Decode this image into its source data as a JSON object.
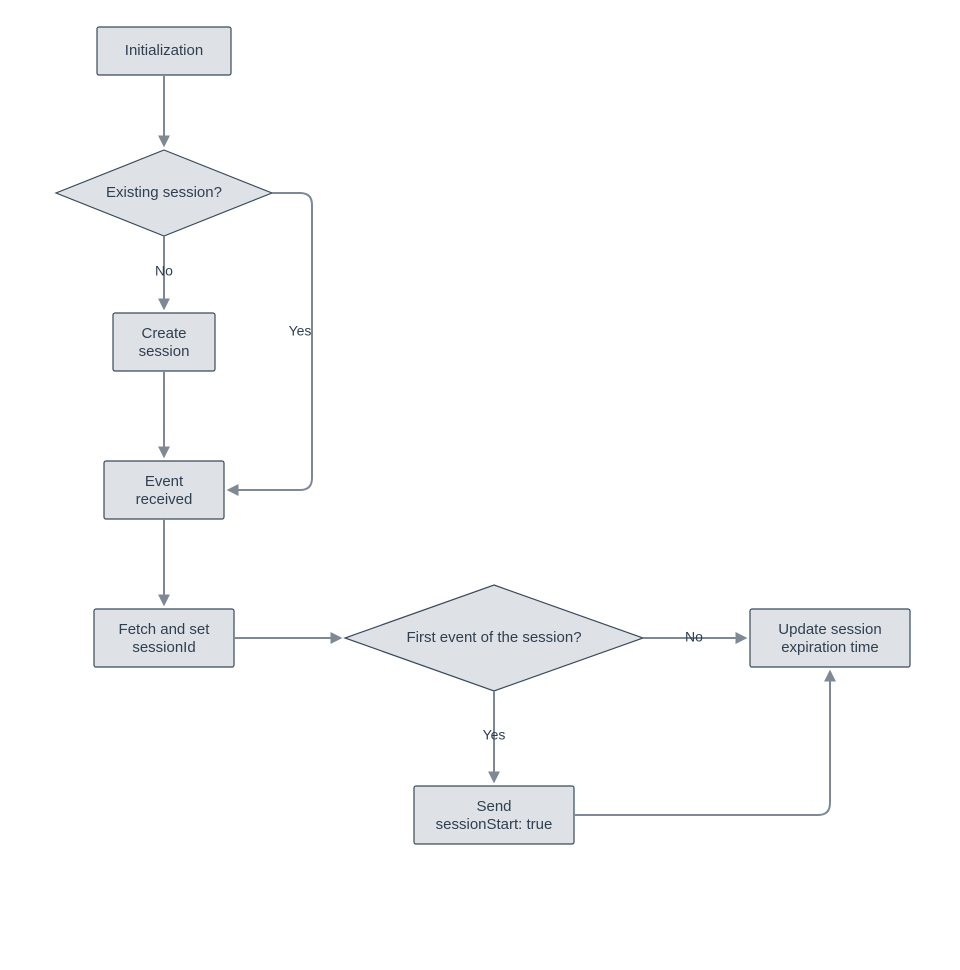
{
  "nodes": {
    "init": {
      "label": "Initialization"
    },
    "existing": {
      "label": "Existing session?"
    },
    "create": {
      "label_l1": "Create",
      "label_l2": "session"
    },
    "event": {
      "label_l1": "Event",
      "label_l2": "received"
    },
    "fetch": {
      "label_l1": "Fetch and set",
      "label_l2": "sessionId"
    },
    "first": {
      "label": "First event of the session?"
    },
    "send": {
      "label_l1": "Send",
      "label_l2": "sessionStart: true"
    },
    "update": {
      "label_l1": "Update session",
      "label_l2": "expiration time"
    }
  },
  "edges": {
    "existing_no": "No",
    "existing_yes": "Yes",
    "first_no": "No",
    "first_yes": "Yes"
  },
  "colors": {
    "node_fill": "#dee1e5",
    "node_stroke": "#3a4a5c",
    "edge_stroke": "#7e8994",
    "text": "#2f3f50"
  }
}
